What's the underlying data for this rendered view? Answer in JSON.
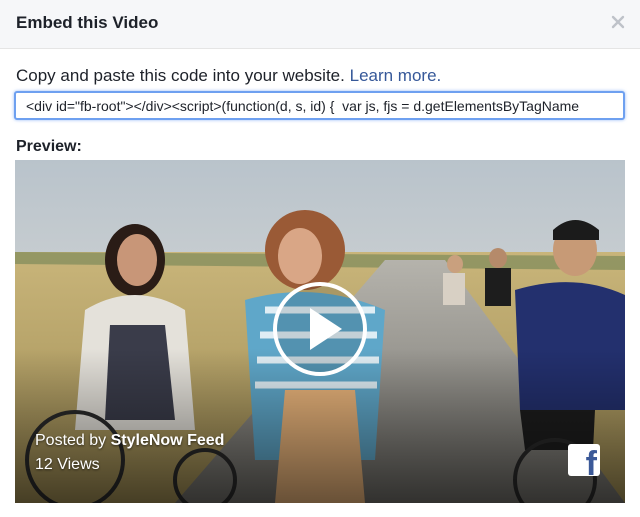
{
  "dialog": {
    "title": "Embed this Video",
    "close_icon": "close-icon"
  },
  "instructions": {
    "text": "Copy and paste this code into your website.",
    "link": "Learn more."
  },
  "code_field": {
    "value": "<div id=\"fb-root\"></div><script>(function(d, s, id) {  var js, fjs = d.getElementsByTagName"
  },
  "preview": {
    "label": "Preview:",
    "posted_prefix": "Posted by",
    "posted_by": "StyleNow Feed",
    "views": "12 Views",
    "play_icon": "play-icon",
    "logo_icon": "facebook-logo-icon"
  },
  "colors": {
    "link": "#365899",
    "header_bg": "#f6f7f9",
    "focus_border": "#6ea0f0",
    "facebook_blue": "#3b5998"
  }
}
